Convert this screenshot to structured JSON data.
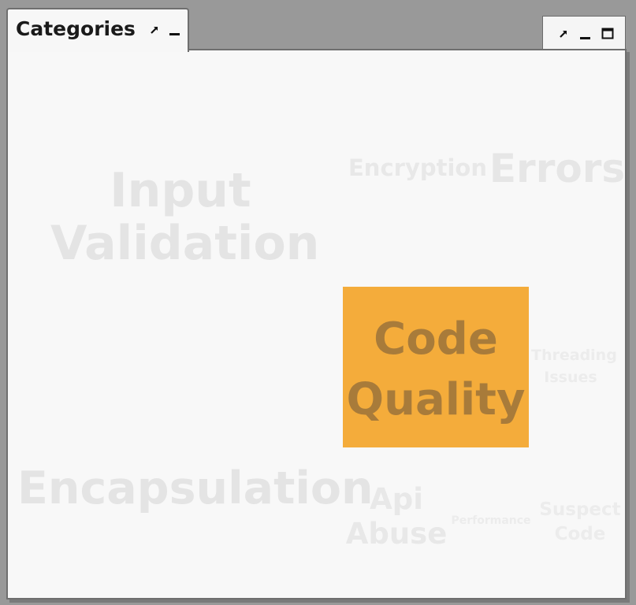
{
  "view": {
    "tab_title": "Categories",
    "tab_controls": [
      "restore-icon",
      "minimize-icon"
    ],
    "toolbar_controls": [
      "restore-icon",
      "minimize-icon",
      "maximize-icon"
    ]
  },
  "tag_cloud": {
    "items": [
      {
        "label": "Input Validation",
        "line1": "Input",
        "line2": "Validation",
        "selected": false
      },
      {
        "label": "Encryption",
        "selected": false
      },
      {
        "label": "Errors",
        "selected": false
      },
      {
        "label": "Code Quality",
        "line1": "Code",
        "line2": "Quality",
        "selected": true
      },
      {
        "label": "Threading Issues",
        "line1": "Threading",
        "line2": "Issues",
        "selected": false
      },
      {
        "label": "Encapsulation",
        "selected": false
      },
      {
        "label": "Api Abuse",
        "line1": "Api",
        "line2": "Abuse",
        "selected": false
      },
      {
        "label": "Performance",
        "selected": false
      },
      {
        "label": "Suspect Code",
        "line1": "Suspect",
        "line2": "Code",
        "selected": false
      }
    ]
  },
  "colors": {
    "selected_bg": "#f4ac3b",
    "selected_text": "#a87b3a",
    "muted_text": "#e6e6e6",
    "panel_bg": "#f8f8f8",
    "frame_bg": "#999999"
  }
}
